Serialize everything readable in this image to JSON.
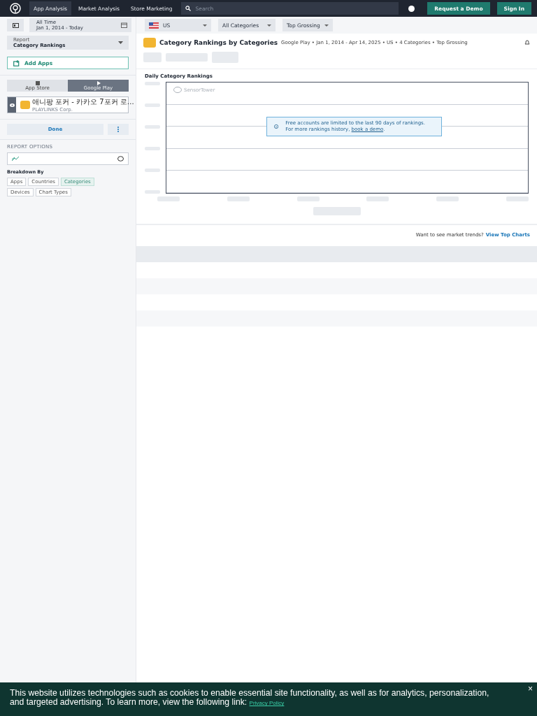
{
  "nav": {
    "tabs": [
      {
        "label": "App Analysis",
        "selected": true
      },
      {
        "label": "Market Analysis",
        "selected": false
      },
      {
        "label": "Store Marketing",
        "selected": false
      }
    ],
    "search": {
      "placeholder": "Search"
    },
    "buttons": [
      "Request a Demo",
      "Sign In"
    ]
  },
  "filters": {
    "date": {
      "label": "All Time",
      "range": "Jan 1, 2014 - Today"
    },
    "country": "US",
    "category": "All Categories",
    "chart_type": "Top Grossing"
  },
  "sidebar": {
    "report": {
      "label": "Report",
      "value": "Category Rankings"
    },
    "add_apps": "Add Apps",
    "stores": [
      {
        "label": "App Store",
        "selected": false
      },
      {
        "label": "Google Play",
        "selected": true
      }
    ],
    "app": {
      "name": "애니팡 포커 - 카카오 7포커 로…",
      "publisher": "PLAYLINKS Corp."
    },
    "done": "Done",
    "options_title": "REPORT OPTIONS",
    "breakdown_title": "Breakdown By",
    "breakdown": [
      {
        "label": "Apps",
        "selected": false
      },
      {
        "label": "Countries",
        "selected": false
      },
      {
        "label": "Categories",
        "selected": true
      },
      {
        "label": "Devices",
        "selected": false
      },
      {
        "label": "Chart Types",
        "selected": false
      }
    ]
  },
  "report": {
    "title": "Category Rankings by Categories",
    "subtitle": "Google Play • Jan 1, 2014 - Apr 14, 2025 • US • 4 Categories • Top Grossing",
    "chart_title": "Daily Category Rankings",
    "watermark": "SensorTower",
    "notice": {
      "text": "Free accounts are limited to the last 90 days of rankings. For more rankings history, ",
      "link": "book a demo",
      "end": "."
    },
    "trends": {
      "text": "Want to see market trends?",
      "link": "View Top Charts"
    }
  },
  "cookie": {
    "text": "This website utilizes technologies such as cookies to enable essential site functionality, as well as for analytics, personalization, and targeted advertising. To learn more, view the following link:",
    "link": "Privacy Policy",
    "close": "×"
  }
}
